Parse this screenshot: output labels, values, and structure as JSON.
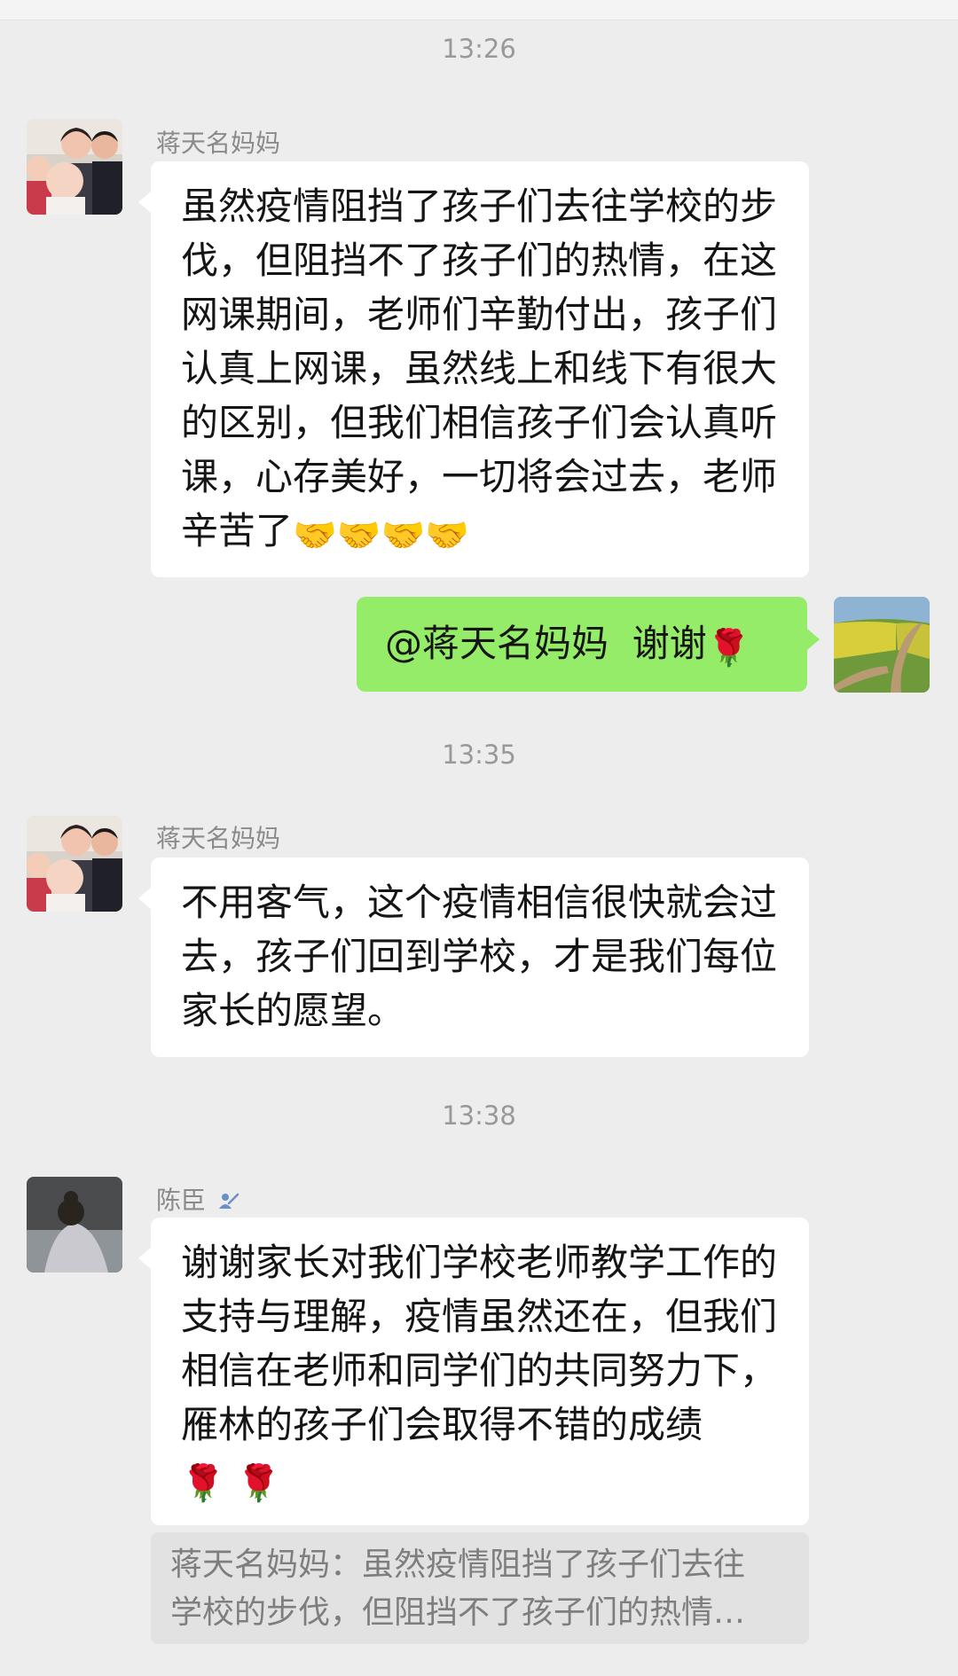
{
  "messages": [
    {
      "timestamp": "13:26",
      "sender": "蒋天名妈妈",
      "text_main": "虽然疫情阻挡了孩子们去往学校的步伐，但阻挡不了孩子们的热情，在这网课期间，老师们辛勤付出，孩子们认真上网课，虽然线上和线下有很大的区别，但我们相信孩子们会认真听课，心存美好，一切将会过去，老师辛苦了",
      "emoji": "🤝🤝🤝🤝"
    },
    {
      "text_main": "@蒋天名妈妈  谢谢",
      "emoji": "🌹"
    },
    {
      "timestamp": "13:35",
      "sender": "蒋天名妈妈",
      "text_main": "不用客气，这个疫情相信很快就会过去，孩子们回到学校，才是我们每位家长的愿望。"
    },
    {
      "timestamp": "13:38",
      "sender": "陈臣",
      "sender_icon": "teacher-badge-icon",
      "text_main": "谢谢家长对我们学校老师教学工作的支持与理解，疫情虽然还在，但我们相信在老师和同学们的共同努力下，雁林的孩子们会取得不错的成绩",
      "emoji": "🌹 🌹",
      "quote_line1": "蒋天名妈妈：虽然疫情阻挡了孩子们去往",
      "quote_line2": "学校的步伐，但阻挡不了孩子们的热情…"
    }
  ],
  "colors": {
    "background": "#ededed",
    "bubble_incoming": "#ffffff",
    "bubble_outgoing": "#95ec69",
    "timestamp_text": "#999999",
    "sender_text": "#8a8a8a",
    "quote_background": "#e2e2e2",
    "quote_text": "#7e7e7e"
  }
}
